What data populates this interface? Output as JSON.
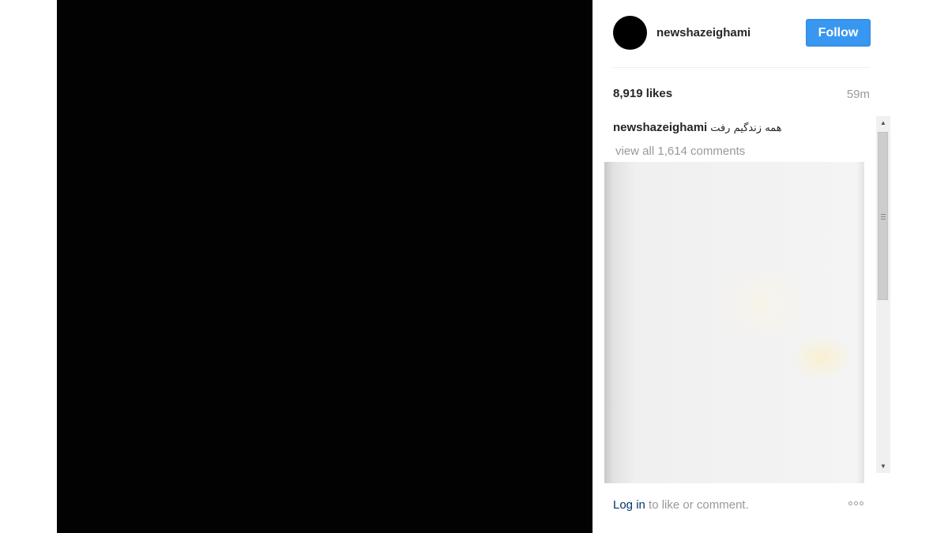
{
  "post": {
    "username": "newshazeighami",
    "follow_label": "Follow",
    "likes": "8,919 likes",
    "time": "59m",
    "caption_user": "newshazeighami",
    "caption_text": "همه زندگیم رفت",
    "view_all": "view all 1,614 comments",
    "login_link": "Log in",
    "login_suffix": " to like or comment."
  },
  "icons": {
    "scroll_up": "scroll-up-arrow",
    "scroll_down": "scroll-down-arrow",
    "more": "more-options-icon"
  },
  "colors": {
    "follow_button": "#3897f0",
    "media_background": "#020203",
    "link": "#003569",
    "muted_text": "#999999"
  }
}
